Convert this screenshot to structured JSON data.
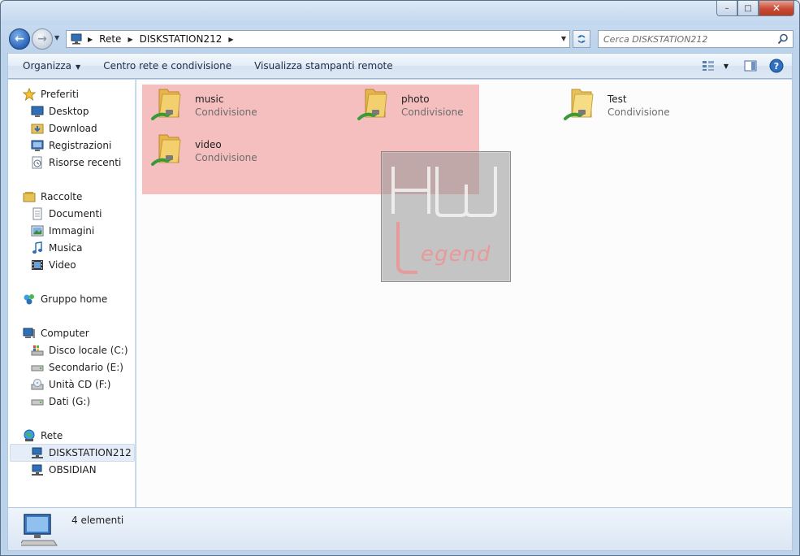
{
  "window": {
    "controls": {
      "minimize": "–",
      "maximize": "□",
      "close": "✕"
    }
  },
  "nav": {
    "back_glyph": "←",
    "forward_glyph": "→",
    "address": {
      "icon": "network-computer-icon",
      "crumbs": [
        "Rete",
        "DISKSTATION212"
      ]
    },
    "search_placeholder": "Cerca DISKSTATION212"
  },
  "toolbar": {
    "organize": "Organizza",
    "network_center": "Centro rete e condivisione",
    "remote_printers": "Visualizza stampanti remote"
  },
  "sidebar": {
    "favorites": {
      "header": "Preferiti",
      "items": [
        "Desktop",
        "Download",
        "Registrazioni",
        "Risorse recenti"
      ]
    },
    "libraries": {
      "header": "Raccolte",
      "items": [
        "Documenti",
        "Immagini",
        "Musica",
        "Video"
      ]
    },
    "homegroup": {
      "header": "Gruppo home"
    },
    "computer": {
      "header": "Computer",
      "items": [
        "Disco locale (C:)",
        "Secondario (E:)",
        "Unità CD (F:)",
        "Dati (G:)"
      ]
    },
    "network": {
      "header": "Rete",
      "items": [
        "DISKSTATION212",
        "OBSIDIAN"
      ],
      "selected": "DISKSTATION212"
    }
  },
  "shares": [
    {
      "name": "music",
      "type": "Condivisione"
    },
    {
      "name": "photo",
      "type": "Condivisione"
    },
    {
      "name": "Test",
      "type": "Condivisione"
    },
    {
      "name": "video",
      "type": "Condivisione"
    }
  ],
  "watermark": {
    "line1": "HW",
    "line2": "Legend"
  },
  "status": {
    "count": "4 elementi"
  },
  "colors": {
    "highlight": "#ef8c8c",
    "accent": "#2a64b8"
  }
}
